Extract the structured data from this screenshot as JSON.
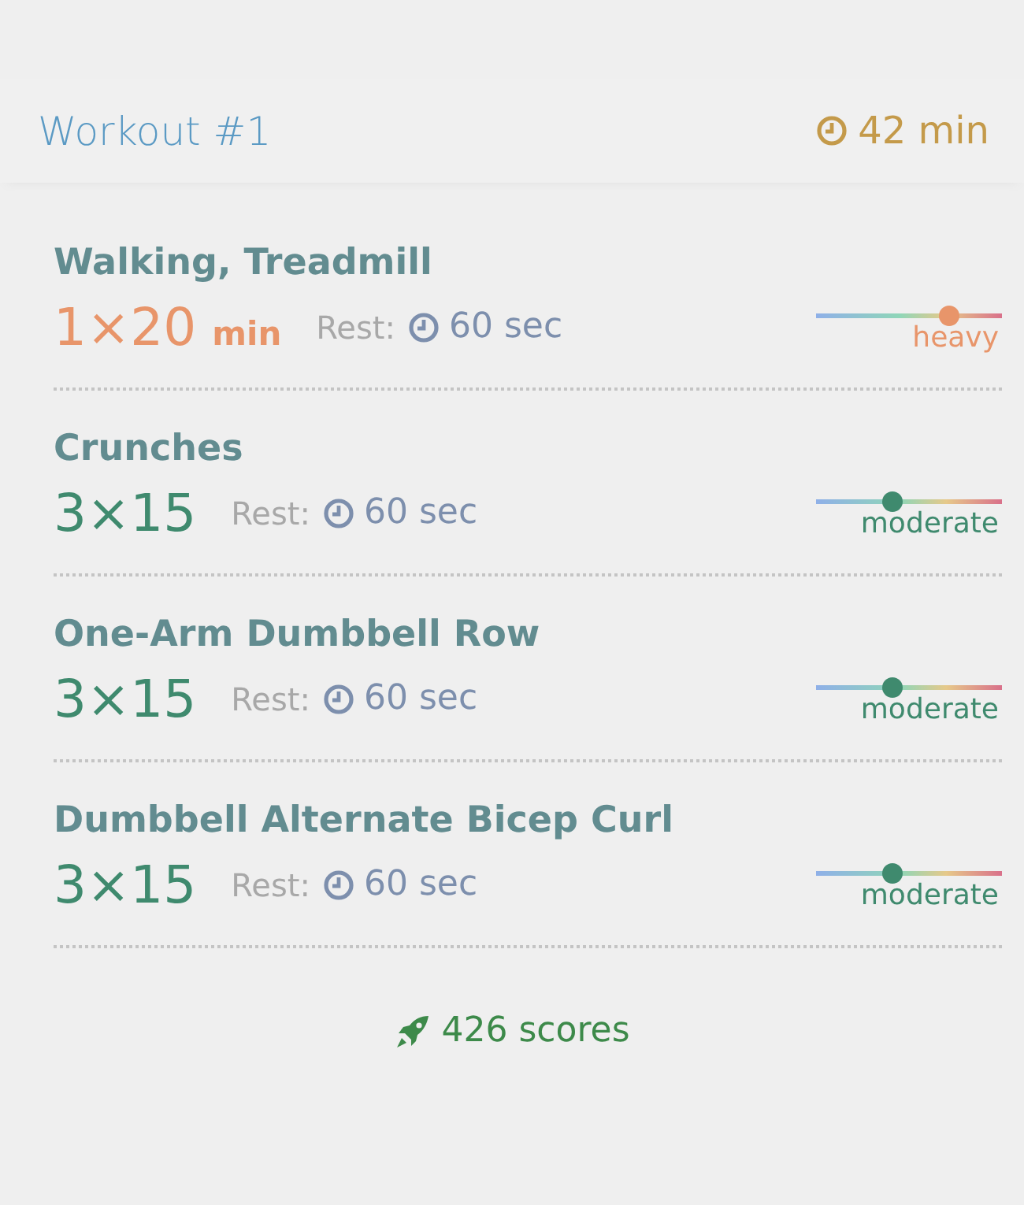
{
  "workout": {
    "title": "Workout #1",
    "duration": "42 min"
  },
  "exercises": [
    {
      "name": "Walking, Treadmill",
      "sets": "1×20",
      "unit": "min",
      "rest_label": "Rest:",
      "rest": "60 sec",
      "level": 0.71,
      "intensity": "heavy",
      "color": "#e8956a"
    },
    {
      "name": "Crunches",
      "sets": "3×15",
      "rest_label": "Rest:",
      "rest": "60 sec",
      "level": 0.41,
      "intensity": "moderate",
      "color": "#3f8a6e"
    },
    {
      "name": "One-Arm Dumbbell Row",
      "sets": "3×15",
      "rest_label": "Rest:",
      "rest": "60 sec",
      "level": 0.41,
      "intensity": "moderate",
      "color": "#3f8a6e"
    },
    {
      "name": "Dumbbell Alternate Bicep Curl",
      "sets": "3×15",
      "rest_label": "Rest:",
      "rest": "60 sec",
      "level": 0.41,
      "intensity": "moderate",
      "color": "#3f8a6e"
    }
  ],
  "footer": {
    "scores": "426 scores"
  }
}
